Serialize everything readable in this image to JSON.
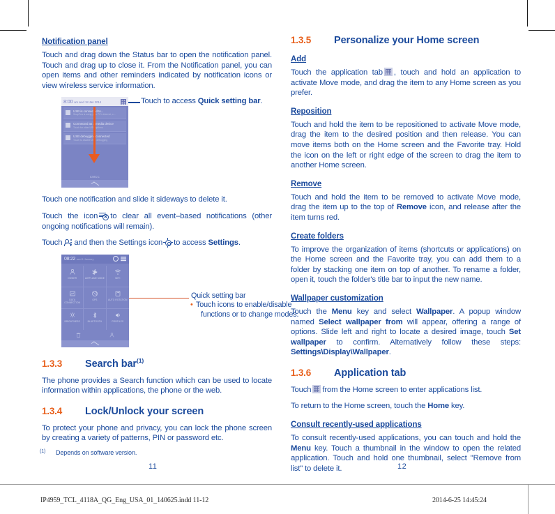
{
  "document": {
    "page_left": "11",
    "page_right": "12",
    "footnote_mark": "(1)",
    "footnote_text": "Depends on software version.",
    "footer_file": "IP4959_TCL_4118A_QG_Eng_USA_01_140625.indd  11-12",
    "footer_date": "2014-6-25  14:45:24"
  },
  "colors": {
    "heading_blue": "#1b4a9c",
    "section_orange": "#e8601c",
    "phone_purple": "#7b84c4",
    "arrow_orange": "#ea5b20"
  },
  "left_column": {
    "notification_panel": {
      "heading": "Notification panel",
      "paragraph": "Touch and drag down the Status bar to open the notification panel. Touch and drag up to close it. From the Notification panel, you can open items and other reminders indicated by notification icons or view wireless service information."
    },
    "figure_notification": {
      "callout_prefix": "Touch to access ",
      "callout_bold": "Quick setting bar",
      "callout_suffix": ".",
      "status_time": "8:00",
      "status_meta": "am  wed  18 Jan 2014",
      "status_icon": "quick-settings-grid-icon",
      "carrier": "CMCC",
      "notifications": [
        {
          "icon": "usb-connected-icon",
          "title": "USB is connected to...",
          "subtitle": "SnapPea is using your PC's internet, c...",
          "time": "01/01/2014"
        },
        {
          "icon": "media-device-icon",
          "title": "Connected as a media device",
          "subtitle": "Touch for other USB options."
        },
        {
          "icon": "usb-debug-icon",
          "title": "USB debugging connected",
          "subtitle": "Touch to disable USB debugging"
        }
      ]
    },
    "para_slide": "Touch one notification and slide it sideways to delete it.",
    "para_clear_a": "Touch the icon",
    "para_clear_b": "to clear all event–based notifications (other ongoing notifications will remain).",
    "para_settings_a": "Touch",
    "para_settings_b": "and then the Settings icon",
    "para_settings_c": "to access",
    "para_settings_bold": "Settings",
    "para_settings_d": ".",
    "figure_quicksetting": {
      "status_time": "08:22",
      "status_meta": "wed 1 January",
      "callout_title": "Quick setting bar",
      "callout_bullet": "Touch icons to enable/disable",
      "callout_bullet_cont": "functions or to change modes.",
      "tiles": [
        {
          "icon": "user-icon",
          "label": "OWNER"
        },
        {
          "icon": "airplane-icon",
          "label": "AIRPLANE MODE"
        },
        {
          "icon": "wifi-icon",
          "label": "WIFI"
        },
        {
          "icon": "data-connection-icon",
          "label": "DATA CONNECTION"
        },
        {
          "icon": "gps-icon",
          "label": "GPS"
        },
        {
          "icon": "auto-rotation-icon",
          "label": "AUTO ROTATION"
        },
        {
          "icon": "brightness-icon",
          "label": "BRIGHTNESS"
        },
        {
          "icon": "bluetooth-icon",
          "label": "BLUETOOTH"
        },
        {
          "icon": "profiles-icon",
          "label": "PROFILES"
        }
      ]
    },
    "section_133": {
      "number": "1.3.3",
      "title": "Search bar",
      "superscript": "(1)",
      "paragraph": "The phone provides a Search function which can be used to locate information within applications, the phone or the web."
    },
    "section_134": {
      "number": "1.3.4",
      "title": "Lock/Unlock your screen",
      "paragraph": "To protect your phone and privacy, you can lock the phone screen by creating a variety of patterns, PIN or password etc."
    }
  },
  "right_column": {
    "section_135": {
      "number": "1.3.5",
      "title": "Personalize your Home screen"
    },
    "add": {
      "heading": "Add",
      "text_a": "Touch the application tab",
      "icon": "application-tab-icon",
      "text_b": ", touch and hold an application to activate Move mode, and drag the item to any Home screen as you prefer."
    },
    "reposition": {
      "heading": "Reposition",
      "paragraph": "Touch and hold the item to be repositioned to activate Move mode, drag the item to the desired position and then release. You can move items both on the Home screen and the Favorite tray. Hold the icon on the left or right edge of the screen to drag the item to another Home screen."
    },
    "remove": {
      "heading": "Remove",
      "text_a": "Touch and hold the item to be removed to activate Move mode, drag the item up to the top of ",
      "bold": "Remove",
      "text_b": " icon, and release after the item turns red."
    },
    "create_folders": {
      "heading": "Create folders",
      "paragraph": "To improve the organization of items (shortcuts or applications) on the Home screen and the Favorite tray, you can add them to a folder by stacking one item on top of another. To rename a folder, open it, touch the folder's title bar to input the new name."
    },
    "wallpaper": {
      "heading": "Wallpaper customization",
      "t1": "Touch the ",
      "b1": "Menu",
      "t2": " key and select ",
      "b2": "Wallpaper",
      "t3": ". A popup window named ",
      "b3": "Select wallpaper from",
      "t4": " will appear, offering a range of options. Slide left and right to locate a desired image, touch ",
      "b4": "Set wallpaper",
      "t5": " to confirm. Alternatively follow these steps: ",
      "b5": "Settings\\Display\\Wallpaper",
      "t6": "."
    },
    "section_136": {
      "number": "1.3.6",
      "title": "Application tab",
      "line1_a": "Touch",
      "line1_icon": "application-tab-icon",
      "line1_b": "from the Home screen to enter applications list.",
      "line2_a": "To return to the Home screen, touch the ",
      "line2_bold": "Home",
      "line2_b": " key."
    },
    "consult": {
      "heading": "Consult recently-used applications",
      "t1": "To consult recently-used applications, you can touch and hold the ",
      "b1": "Menu",
      "t2": " key. Touch a thumbnail in the window to open the related application. Touch and hold one thumbnail, select \"Remove from list\" to delete it."
    }
  }
}
